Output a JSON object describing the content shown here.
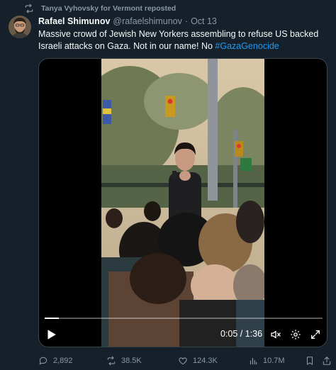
{
  "repost": {
    "label": "Tanya Vyhovsky for Vermont reposted",
    "icon": "repost-icon"
  },
  "author": {
    "name": "Rafael Shimunov",
    "handle": "@rafaelshimunov",
    "separator": "·",
    "date": "Oct 13"
  },
  "tweet": {
    "text_before": "Massive crowd of Jewish New Yorkers assembling to refuse US backed Israeli attacks on Gaza. Not in our name! No ",
    "hashtag": "#GazaGenocide"
  },
  "video": {
    "time": "0:05 / 1:36",
    "progress": 0.052,
    "controls": [
      "play-icon",
      "mute-icon",
      "settings-icon",
      "fullscreen-icon"
    ]
  },
  "actions": {
    "replies": "2,892",
    "reposts": "38.5K",
    "likes": "124.3K",
    "views": "10.7M"
  },
  "colors": {
    "background": "#15202b",
    "text": "#f7f9f9",
    "muted": "#8b98a5",
    "link": "#1d9bf0",
    "border": "#38444d"
  }
}
